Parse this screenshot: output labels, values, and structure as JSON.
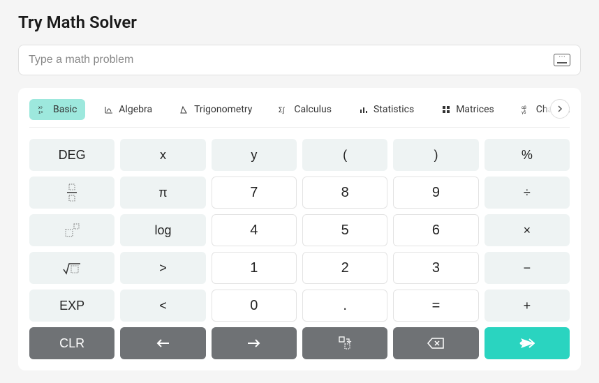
{
  "title": "Try Math Solver",
  "input": {
    "placeholder": "Type a math problem",
    "value": ""
  },
  "tabs": [
    {
      "id": "basic",
      "label": "Basic",
      "active": true
    },
    {
      "id": "algebra",
      "label": "Algebra",
      "active": false
    },
    {
      "id": "trig",
      "label": "Trigonometry",
      "active": false
    },
    {
      "id": "calculus",
      "label": "Calculus",
      "active": false
    },
    {
      "id": "statistics",
      "label": "Statistics",
      "active": false
    },
    {
      "id": "matrices",
      "label": "Matrices",
      "active": false
    },
    {
      "id": "characters",
      "label": "Characters",
      "active": false
    }
  ],
  "keys": {
    "r0": [
      "DEG",
      "x",
      "y",
      "(",
      ")",
      "%"
    ],
    "r1_fn": [
      "fraction",
      "π"
    ],
    "r1_num": [
      "7",
      "8",
      "9"
    ],
    "r1_op": "÷",
    "r2_fn": [
      "exponent",
      "log"
    ],
    "r2_num": [
      "4",
      "5",
      "6"
    ],
    "r2_op": "×",
    "r3_fn": [
      "sqrt",
      ">"
    ],
    "r3_num": [
      "1",
      "2",
      "3"
    ],
    "r3_op": "−",
    "r4_fn": [
      "EXP",
      "<"
    ],
    "r4_num": [
      "0",
      ".",
      "="
    ],
    "r4_op": "+",
    "bottom": [
      "CLR",
      "arrow-left",
      "arrow-right",
      "newline",
      "backspace",
      "send"
    ]
  }
}
